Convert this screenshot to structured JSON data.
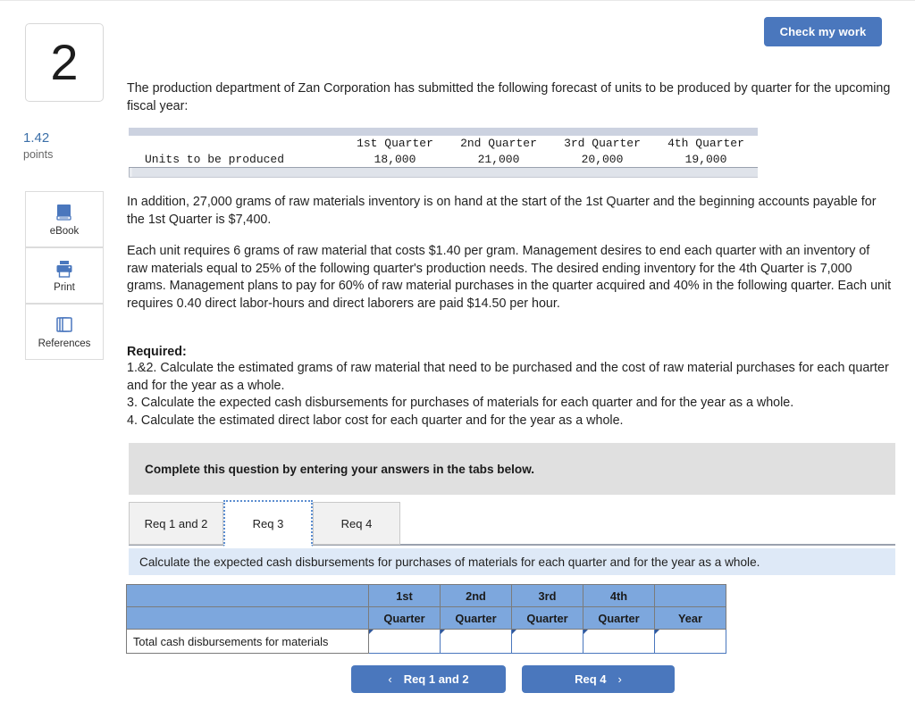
{
  "question": {
    "number": "2",
    "points_value": "1.42",
    "points_label": "points"
  },
  "check_button": {
    "label": "Check my work"
  },
  "tools": [
    {
      "name": "ebook",
      "label": "eBook",
      "icon": "book-icon"
    },
    {
      "name": "print",
      "label": "Print",
      "icon": "printer-icon"
    },
    {
      "name": "references",
      "label": "References",
      "icon": "copy-pages-icon"
    }
  ],
  "body": {
    "intro": "The production department of Zan Corporation has submitted the following forecast of units to be produced by quarter for the upcoming fiscal year:",
    "addition": "In addition, 27,000 grams of raw materials inventory is on hand at the start of the 1st Quarter and the beginning accounts payable for the 1st Quarter is $7,400.",
    "each_unit": "Each unit requires 6 grams of raw material that costs $1.40 per gram. Management desires to end each quarter with an inventory of raw materials equal to 25% of the following quarter's production needs. The desired ending inventory for the 4th Quarter is 7,000 grams. Management plans to pay for 60% of raw material purchases in the quarter acquired and 40% in the following quarter. Each unit requires 0.40 direct labor-hours and direct laborers are paid $14.50 per hour.",
    "required_heading": "Required:",
    "requirements": [
      "1.&2. Calculate the estimated grams of raw material that need to be purchased and the cost of raw material purchases for each quarter and for the year as a whole.",
      "3. Calculate the expected cash disbursements for purchases of materials for each quarter and for the year as a whole.",
      "4. Calculate the estimated direct labor cost for each quarter and for the year as a whole."
    ]
  },
  "forecast_table": {
    "columns": [
      "",
      "1st Quarter",
      "2nd Quarter",
      "3rd Quarter",
      "4th Quarter"
    ],
    "row_label": "Units to be produced",
    "values": [
      "18,000",
      "21,000",
      "20,000",
      "19,000"
    ]
  },
  "banner": {
    "text": "Complete this question by entering your answers in the tabs below."
  },
  "tabs": [
    {
      "label": "Req 1 and 2",
      "active": false
    },
    {
      "label": "Req 3",
      "active": true
    },
    {
      "label": "Req 4",
      "active": false
    }
  ],
  "instruction": {
    "text": "Calculate the expected cash disbursements for purchases of materials for each quarter and for the year as a whole."
  },
  "answer_table": {
    "header_row_1": [
      "",
      "1st",
      "2nd",
      "3rd",
      "4th",
      ""
    ],
    "header_row_2": [
      "",
      "Quarter",
      "Quarter",
      "Quarter",
      "Quarter",
      "Year"
    ],
    "rows": [
      {
        "label": "Total cash disbursements for materials",
        "values": [
          "",
          "",
          "",
          "",
          ""
        ]
      }
    ]
  },
  "nav": {
    "prev_label": "Req 1 and 2",
    "prev_chevron": "‹",
    "next_label": "Req 4",
    "next_chevron": "›"
  },
  "colors": {
    "accent_blue": "#4a77bd",
    "table_header_blue": "#7da7dd",
    "instruction_blue": "#dee9f7",
    "banner_grey": "#e0e0e0",
    "points_blue": "#3b6fa8"
  }
}
